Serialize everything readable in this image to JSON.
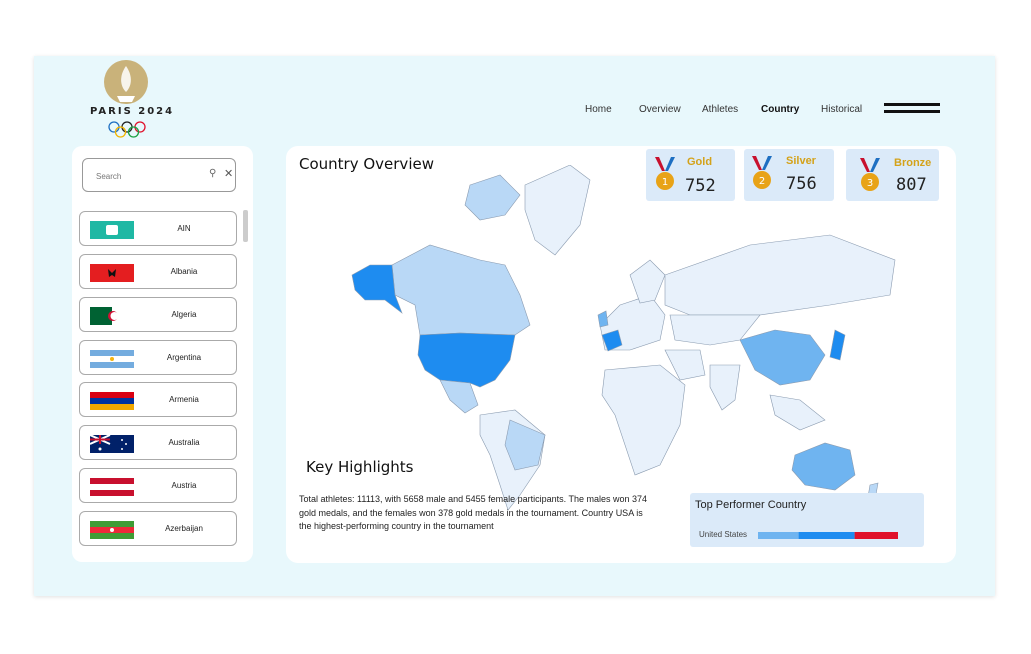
{
  "brand": {
    "logo_text": "PARIS 2024"
  },
  "nav": {
    "items": [
      "Home",
      "Overview",
      "Athletes",
      "Country",
      "Historical"
    ],
    "active": "Country"
  },
  "search": {
    "placeholder": "Search",
    "value": ""
  },
  "countries": [
    "AIN",
    "Albania",
    "Algeria",
    "Argentina",
    "Armenia",
    "Australia",
    "Austria",
    "Azerbaijan"
  ],
  "main": {
    "title": "Country Overview"
  },
  "medals": {
    "gold": {
      "label": "Gold",
      "value": "752",
      "number": "1"
    },
    "silver": {
      "label": "Silver",
      "value": "756",
      "number": "2"
    },
    "bronze": {
      "label": "Bronze",
      "value": "807",
      "number": "3"
    }
  },
  "highlights": {
    "title": "Key Highlights",
    "text": "Total athletes: 11113, with 5658 male and 5455 female participants. The males won 374 gold medals, and the females won 378 gold medals in the tournament. Country USA is the highest-performing country in the tournament"
  },
  "top_performer": {
    "title": "Top Performer Country",
    "country": "United States",
    "bar": [
      {
        "share": 0.29,
        "color": "#6fb4f0"
      },
      {
        "share": 0.4,
        "color": "#1e8cf0"
      },
      {
        "share": 0.31,
        "color": "#e0112b"
      }
    ]
  },
  "colors": {
    "accent": "#1e8cf0",
    "map_light": "#e8f1fb",
    "map_mid": "#b9d8f6",
    "gold_text": "#d4a21a"
  }
}
